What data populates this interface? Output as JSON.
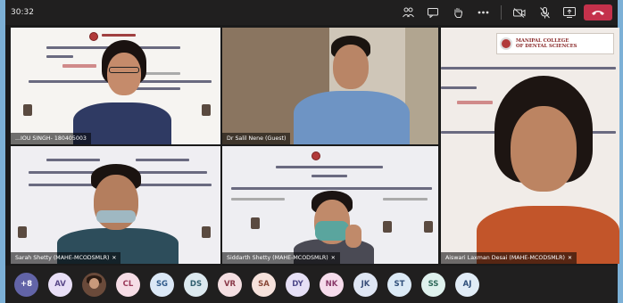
{
  "meeting": {
    "clock": "30:32",
    "toolbar": {
      "participants_icon": "people-icon",
      "chat_icon": "chat-icon",
      "raise_hand_icon": "hand-icon",
      "more_icon": "more-icon",
      "camera_icon": "camera-off-icon",
      "mic_icon": "mic-off-icon",
      "share_icon": "share-screen-icon",
      "leave_icon": "phone-hangup-icon"
    }
  },
  "tiles": [
    {
      "name": "...IOU SINGH- 180405003"
    },
    {
      "name": "Dr Salil Nene (Guest)"
    },
    {
      "name": "Aiswari Laxman Desai (MAHE-MCODSMLR)"
    },
    {
      "name": "Sarah Shetty (MAHE-MCODSMLR)"
    },
    {
      "name": "Siddarth Shetty (MAHE-MCODSMLR)"
    }
  ],
  "slide_header": {
    "line1": "MANIPAL COLLEGE",
    "line2": "OF DENTAL SCIENCES"
  },
  "roster": {
    "overflow": "+8",
    "avatars": [
      {
        "initials": "AV",
        "bg": "#e8dff6",
        "fg": "#5b4a8a"
      },
      {
        "initials": "",
        "photo": true
      },
      {
        "initials": "CL",
        "bg": "#f6dde6",
        "fg": "#9a3a5a"
      },
      {
        "initials": "SG",
        "bg": "#dbe8f6",
        "fg": "#2f5a8a"
      },
      {
        "initials": "DS",
        "bg": "#dce9ef",
        "fg": "#2f5f6f"
      },
      {
        "initials": "VR",
        "bg": "#f4dfe2",
        "fg": "#8a3a4a"
      },
      {
        "initials": "SA",
        "bg": "#f6e2dc",
        "fg": "#8a4a3a"
      },
      {
        "initials": "DY",
        "bg": "#e6e0f6",
        "fg": "#4f4a8a"
      },
      {
        "initials": "NK",
        "bg": "#f6dcec",
        "fg": "#8a3a6a"
      },
      {
        "initials": "JK",
        "bg": "#dfe6f4",
        "fg": "#3a4f7a"
      },
      {
        "initials": "ST",
        "bg": "#dceaf6",
        "fg": "#2f4f7a"
      },
      {
        "initials": "SS",
        "bg": "#dff2ee",
        "fg": "#2f6a5a"
      },
      {
        "initials": "AJ",
        "bg": "#e1ecf6",
        "fg": "#2f4f7a"
      }
    ]
  }
}
